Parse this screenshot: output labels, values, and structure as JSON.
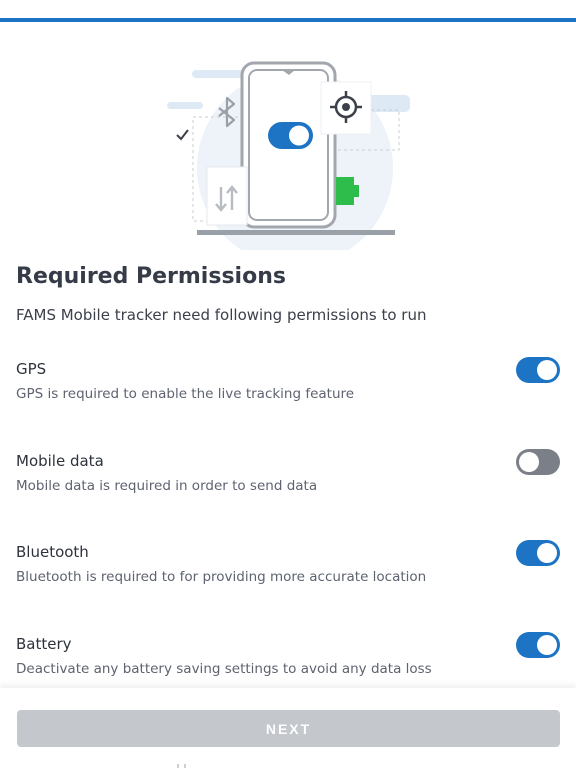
{
  "header": {
    "accent_color": "#1d74c4"
  },
  "illustration": {
    "icons": [
      "bluetooth-icon",
      "crosshair-icon",
      "toggle-icon",
      "data-transfer-icon",
      "battery-icon",
      "checkmark-icon"
    ]
  },
  "page": {
    "title": "Required Permissions",
    "subtitle": "FAMS Mobile tracker need following permissions to run"
  },
  "permissions": [
    {
      "name": "GPS",
      "description": "GPS is required to enable the live tracking feature",
      "enabled": true
    },
    {
      "name": "Mobile data",
      "description": "Mobile data is required in order to send data",
      "enabled": false
    },
    {
      "name": "Bluetooth",
      "description": "Bluetooth is required to for providing more accurate location",
      "enabled": true
    },
    {
      "name": "Battery",
      "description": "Deactivate any battery saving settings to avoid any data loss",
      "enabled": true
    }
  ],
  "footer": {
    "next_label": "NEXT"
  },
  "colors": {
    "toggle_on": "#1d74c4",
    "toggle_off": "#7b7f87",
    "button_disabled": "#c4c7cc"
  }
}
